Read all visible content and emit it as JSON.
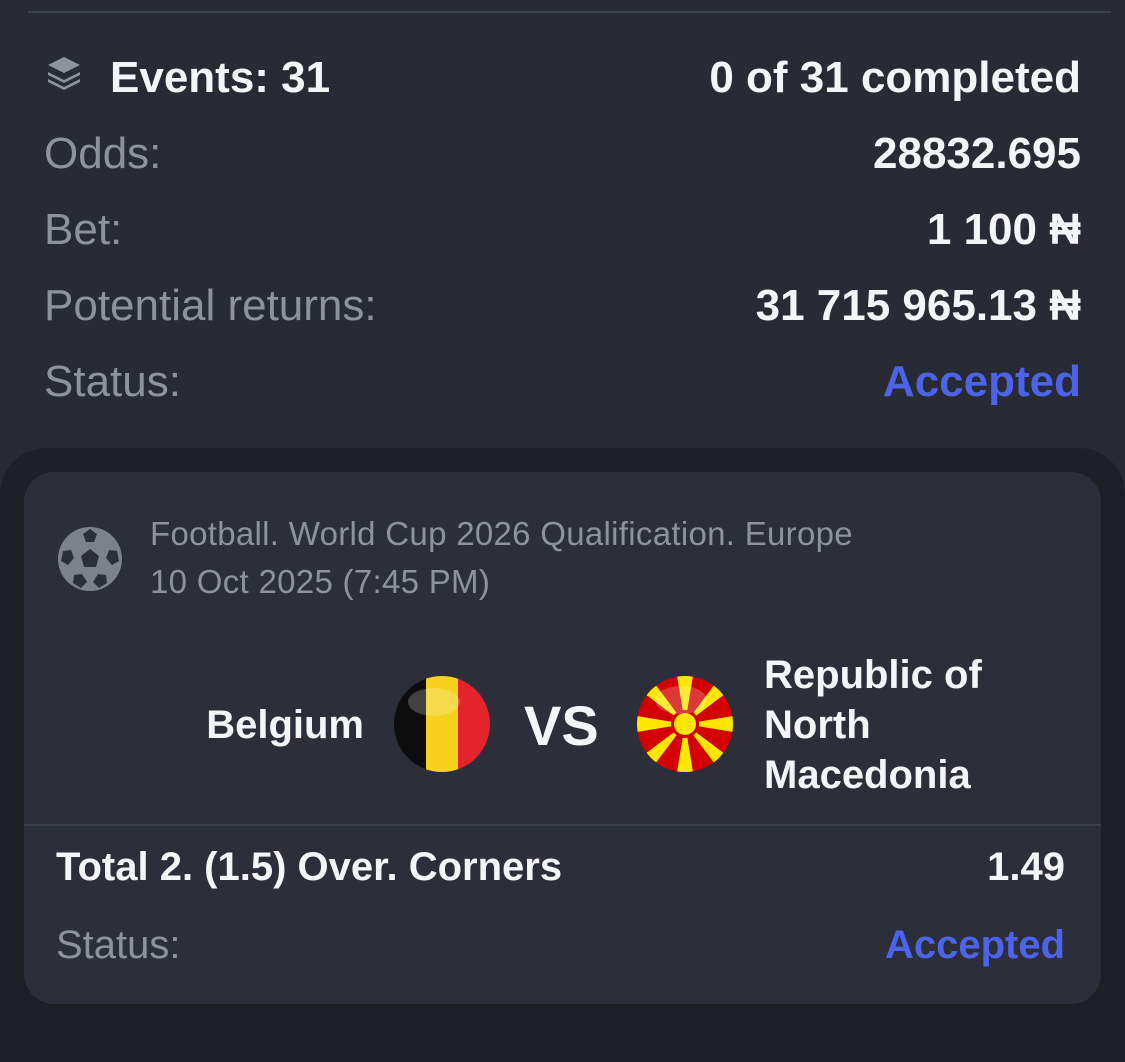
{
  "summary": {
    "events_label": "Events: 31",
    "completed": "0 of 31 completed",
    "odds_label": "Odds:",
    "odds_value": "28832.695",
    "bet_label": "Bet:",
    "bet_value": "1 100 ₦",
    "returns_label": "Potential returns:",
    "returns_value": "31 715 965.13 ₦",
    "status_label": "Status:",
    "status_value": "Accepted"
  },
  "event": {
    "competition": "Football. World Cup 2026 Qualification. Europe",
    "datetime": "10 Oct 2025 (7:45 PM)",
    "home_team": "Belgium",
    "vs": "VS",
    "away_team_line1": "Republic of",
    "away_team_line2": "North",
    "away_team_line3": "Macedonia",
    "market": "Total 2. (1.5) Over. Corners",
    "market_odds": "1.49",
    "status_label": "Status:",
    "status_value": "Accepted"
  },
  "icons": {
    "stack": "layers-icon",
    "sport": "football-icon",
    "home_flag": "belgium-flag-icon",
    "away_flag": "north-macedonia-flag-icon"
  },
  "colors": {
    "background": "#282b34",
    "card": "#2c2f39",
    "accent": "#4c63ea",
    "muted_text": "#8e929b",
    "primary_text": "#f4f5f7"
  }
}
